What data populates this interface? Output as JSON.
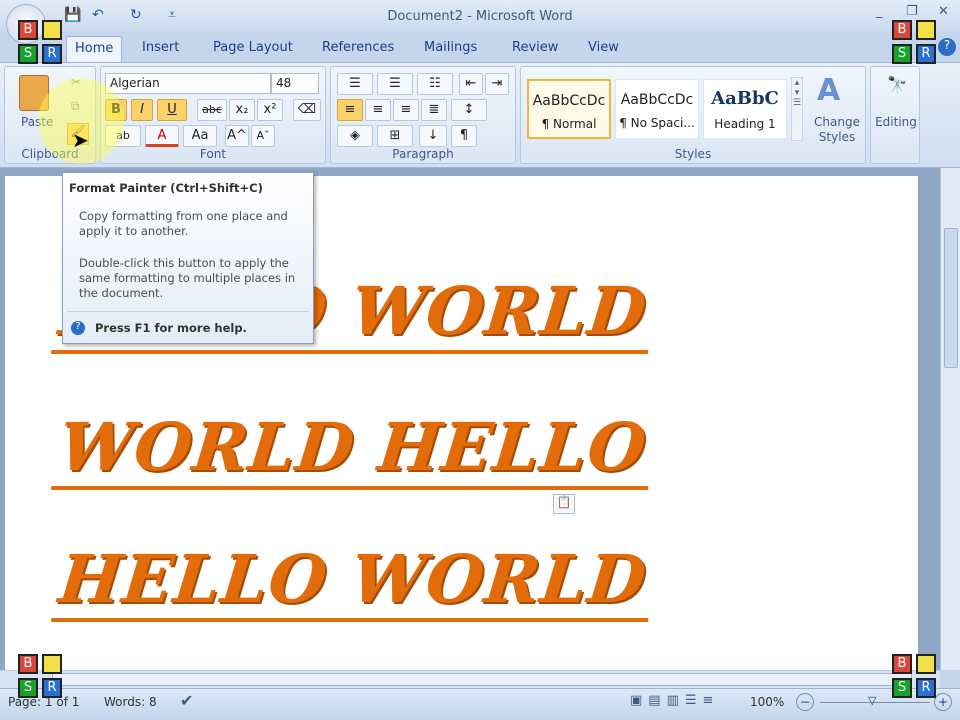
{
  "window": {
    "title": "Document2 - Microsoft Word"
  },
  "qat": {
    "save": "💾",
    "undo": "↶",
    "redo": "↻",
    "customize": "⩡"
  },
  "tabs": [
    "Home",
    "Insert",
    "Page Layout",
    "References",
    "Mailings",
    "Review",
    "View"
  ],
  "clipboard": {
    "label": "Clipboard",
    "paste": "Paste"
  },
  "font": {
    "label": "Font",
    "name": "Algerian",
    "size": "48",
    "bold": "B",
    "italic": "I",
    "underline": "U",
    "strike": "abc",
    "subscript": "x₂",
    "superscript": "x²",
    "highlight": "ab",
    "color": "A",
    "case": "Aa",
    "grow": "A^",
    "shrink": "Aˇ"
  },
  "paragraph": {
    "label": "Paragraph",
    "pilcrow": "¶"
  },
  "styles": {
    "label": "Styles",
    "items": [
      {
        "preview": "AaBbCcDc",
        "name": "¶ Normal"
      },
      {
        "preview": "AaBbCcDc",
        "name": "¶ No Spaci..."
      },
      {
        "preview": "AaBbC",
        "name": "Heading 1"
      }
    ],
    "change_styles": "Change Styles"
  },
  "editing": {
    "label": "Editing"
  },
  "tooltip": {
    "title": "Format Painter (Ctrl+Shift+C)",
    "desc1": "Copy formatting from one place and apply it to another.",
    "desc2": "Double-click this button to apply the same formatting to multiple places in the document.",
    "help": "Press F1 for more help."
  },
  "document": {
    "lines": [
      "HELLO WORLD",
      "WORLD HELLO",
      "HELLO WORLD"
    ]
  },
  "status": {
    "page": "Page: 1 of 1",
    "words": "Words: 8",
    "zoom": "100%"
  },
  "overlay": {
    "b": "B",
    "s": "S",
    "r": "R"
  },
  "colors": {
    "text": "#e36c0a",
    "accent": "#fbd26a"
  }
}
